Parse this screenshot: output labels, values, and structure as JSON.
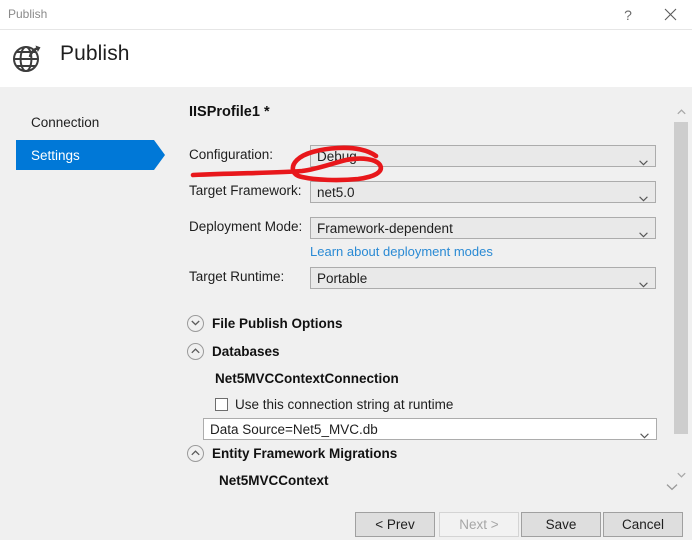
{
  "window": {
    "title": "Publish",
    "help_label": "?",
    "close_label": "×"
  },
  "header": {
    "title": "Publish",
    "icon": "globe-publish-icon"
  },
  "sidebar": {
    "items": [
      {
        "label": "Connection",
        "selected": false
      },
      {
        "label": "Settings",
        "selected": true
      }
    ]
  },
  "main": {
    "profile_title": "IISProfile1 *",
    "fields": [
      {
        "label": "Configuration:",
        "value": "Debug"
      },
      {
        "label": "Target Framework:",
        "value": "net5.0"
      },
      {
        "label": "Deployment Mode:",
        "value": "Framework-dependent"
      },
      {
        "label": "Target Runtime:",
        "value": "Portable"
      }
    ],
    "deployment_link": "Learn about deployment modes",
    "sections": [
      {
        "label": "File Publish Options",
        "expanded": false,
        "icon": "chevron-down-icon"
      },
      {
        "label": "Databases",
        "expanded": true,
        "icon": "chevron-up-icon"
      },
      {
        "label": "Entity Framework Migrations",
        "expanded": true,
        "icon": "chevron-up-icon"
      }
    ],
    "database": {
      "name": "Net5MVCContextConnection",
      "checkbox_label": "Use this connection string at runtime",
      "checkbox_checked": false,
      "connection_string": "Data Source=Net5_MVC.db"
    },
    "migrations": {
      "context_name": "Net5MVCContext"
    }
  },
  "footer": {
    "buttons": [
      {
        "label": "< Prev",
        "disabled": false
      },
      {
        "label": "Next >",
        "disabled": true
      },
      {
        "label": "Save",
        "disabled": false
      },
      {
        "label": "Cancel",
        "disabled": false
      }
    ]
  },
  "annotation": {
    "type": "hand-drawn-red-circle",
    "target": "Debug",
    "color": "#e8171b"
  },
  "colors": {
    "accent": "#0078d7",
    "link": "#2a8ad4",
    "annotation_red": "#e8171b",
    "window_bg": "#f0f0f0",
    "control_bg": "#e9e9e9"
  }
}
